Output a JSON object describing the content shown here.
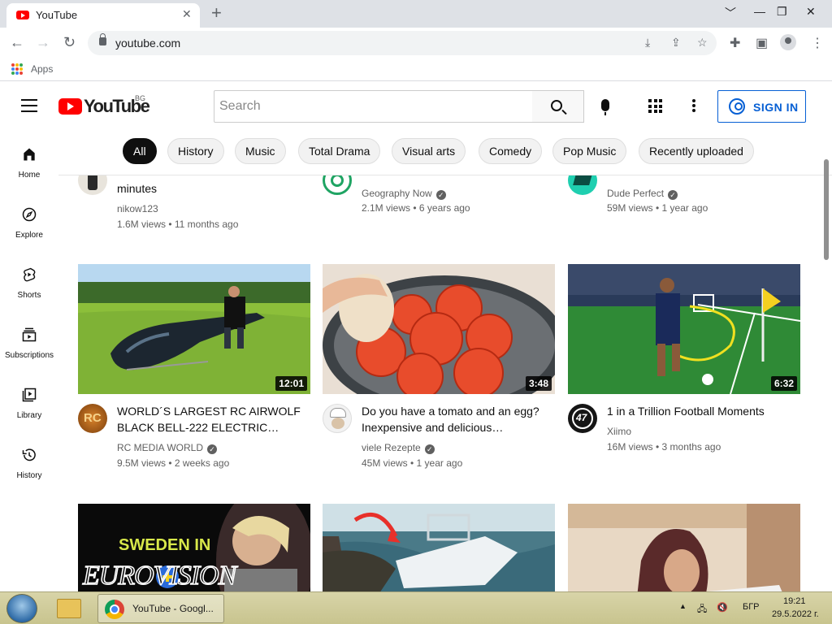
{
  "browser": {
    "tab_title": "YouTube",
    "tab_close": "✕",
    "new_tab": "+",
    "win_minimize": "﹀",
    "win_min": "—",
    "win_restore": "❐",
    "win_close": "✕",
    "back": "←",
    "forward": "→",
    "reload": "↻",
    "url": "youtube.com",
    "apps_label": "Apps"
  },
  "youtube": {
    "wordmark": "YouTube",
    "country": "BG",
    "search_placeholder": "Search",
    "sign_in": "SIGN IN"
  },
  "chips": [
    "All",
    "History",
    "Music",
    "Total Drama",
    "Visual arts",
    "Comedy",
    "Pop Music",
    "Recently uploaded"
  ],
  "sidebar": [
    {
      "label": "Home"
    },
    {
      "label": "Explore"
    },
    {
      "label": "Shorts"
    },
    {
      "label": "Subscriptions"
    },
    {
      "label": "Library"
    },
    {
      "label": "History"
    }
  ],
  "videos_top": [
    {
      "title": "minutes",
      "channel": "nikow123",
      "meta": "1.6M views • 11 months ago"
    },
    {
      "title": "",
      "channel": "Geography Now",
      "meta": "2.1M views • 6 years ago"
    },
    {
      "title": "",
      "channel": "Dude Perfect",
      "meta": "59M views • 1 year ago"
    }
  ],
  "videos_row2": [
    {
      "title": "WORLD´S LARGEST RC AIRWOLF BLACK BELL-222 ELECTRIC…",
      "channel": "RC MEDIA WORLD",
      "meta": "9.5M views • 2 weeks ago",
      "duration": "12:01"
    },
    {
      "title": "Do you have a tomato and an egg? Inexpensive and delicious…",
      "channel": "viele Rezepte",
      "meta": "45M views • 1 year ago",
      "duration": "3:48"
    },
    {
      "title": "1 in a Trillion Football Moments",
      "channel": "Xiimo",
      "meta": "16M views • 3 months ago",
      "duration": "6:32"
    }
  ],
  "thumb_text": {
    "sweden_line1": "SWEDEN IN",
    "sweden_line2": "EUROVISION"
  },
  "taskbar": {
    "chrome_label": "YouTube - Googl...",
    "lang": "БГР",
    "time": "19:21",
    "date": "29.5.2022 г."
  },
  "colors": {
    "youtube_red": "#ff0000",
    "link_blue": "#065fd4",
    "chip_active": "#0f0f0f"
  }
}
